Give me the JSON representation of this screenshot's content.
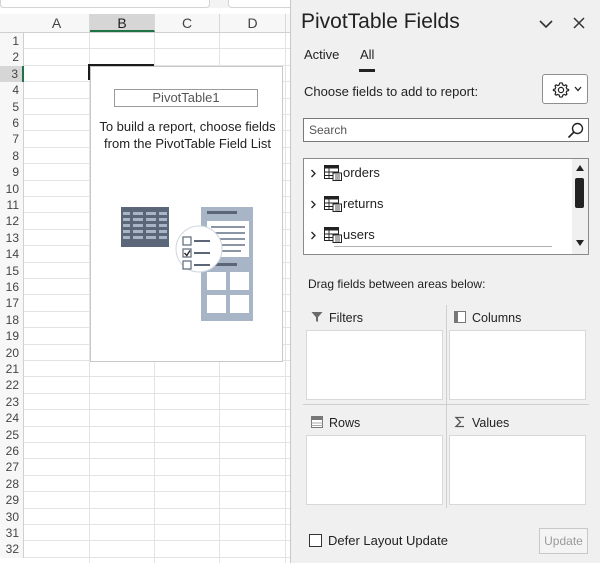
{
  "sheet": {
    "columns": [
      "A",
      "B",
      "C",
      "D"
    ],
    "rows": [
      "1",
      "2",
      "3",
      "4",
      "5",
      "6",
      "7",
      "8",
      "9",
      "10",
      "11",
      "12",
      "13",
      "14",
      "15",
      "16",
      "17",
      "18",
      "19",
      "20",
      "21",
      "22",
      "23",
      "24",
      "25",
      "26",
      "27",
      "28",
      "29",
      "30",
      "31",
      "32"
    ],
    "selected_column": "B",
    "selected_row": "3",
    "pivot_placeholder": {
      "name": "PivotTable1",
      "instructions_line1": "To build a report, choose fields",
      "instructions_line2": "from the PivotTable Field List"
    }
  },
  "pane": {
    "title": "PivotTable Fields",
    "tabs": [
      {
        "label": "Active",
        "active": false
      },
      {
        "label": "All",
        "active": true
      }
    ],
    "choose_label": "Choose fields to add to report:",
    "search": {
      "placeholder": "Search",
      "value": ""
    },
    "fields": [
      {
        "name": "orders",
        "icon": "table-icon"
      },
      {
        "name": "returns",
        "icon": "table-icon"
      },
      {
        "name": "users",
        "icon": "table-icon"
      }
    ],
    "drag_label": "Drag fields between areas below:",
    "areas": {
      "filters": "Filters",
      "columns": "Columns",
      "rows": "Rows",
      "values": "Values"
    },
    "defer_label": "Defer Layout Update",
    "defer_checked": false,
    "update_label": "Update"
  },
  "colors": {
    "pane_bg": "#f0f0f0",
    "selection_accent": "#217346",
    "illustration_dark": "#5b6778",
    "illustration_light": "#a7b5c6"
  }
}
